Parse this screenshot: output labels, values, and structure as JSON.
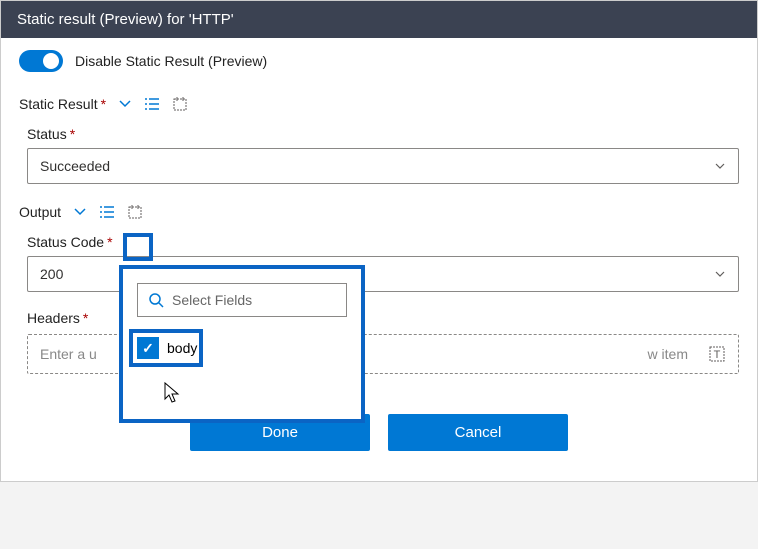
{
  "titlebar": {
    "text": "Static result (Preview) for 'HTTP'"
  },
  "toggle": {
    "label": "Disable Static Result (Preview)",
    "on": true
  },
  "static_result": {
    "label": "Static Result"
  },
  "status": {
    "label": "Status",
    "value": "Succeeded"
  },
  "output": {
    "label": "Output"
  },
  "status_code": {
    "label": "Status Code",
    "value": "200"
  },
  "headers": {
    "label": "Headers",
    "placeholder": "Enter a unique property name",
    "new_item": "New item"
  },
  "popover": {
    "search_placeholder": "Select Fields",
    "option": {
      "label": "body",
      "checked": true
    }
  },
  "buttons": {
    "done": "Done",
    "cancel": "Cancel"
  }
}
